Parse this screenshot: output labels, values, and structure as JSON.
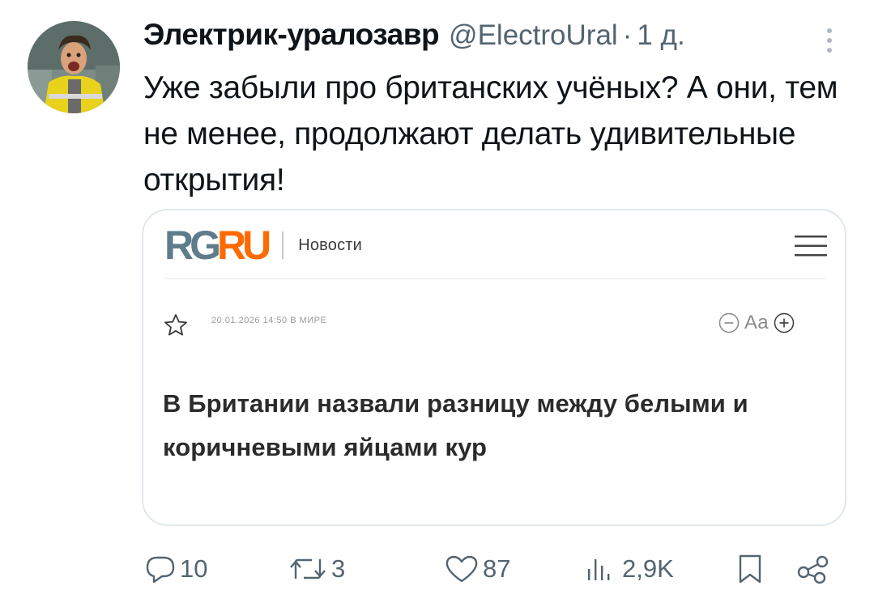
{
  "tweet": {
    "author_name": "Электрик-уралозавр",
    "handle": "@ElectroUral",
    "separator": "·",
    "time": "1 д.",
    "text": "Уже забыли про британских учёных? А они, тем не менее, продолжают делать удивительные открытия!"
  },
  "card": {
    "logo_rg": "RG",
    "logo_ru": "RU",
    "section": "Новости",
    "meta": "20.01.2026 14:50 В МИРЕ",
    "font_size_label": "Аа",
    "headline": "В Британии назвали разницу между белыми и коричневыми яйцами кур"
  },
  "actions": {
    "replies": "10",
    "retweets": "3",
    "likes": "87",
    "views": "2,9K"
  },
  "icons": {
    "more": "more-vertical-icon",
    "menu": "hamburger-menu-icon",
    "star": "star-outline-icon",
    "font_decrease": "minus-circle-icon",
    "font_increase": "plus-circle-icon",
    "reply": "reply-bubble-icon",
    "retweet": "retweet-icon",
    "like": "heart-icon",
    "views": "views-bar-icon",
    "bookmark": "bookmark-icon",
    "share": "share-icon"
  },
  "colors": {
    "text": "#0f1419",
    "muted": "#536471",
    "logo_rg": "#5f7c8a",
    "logo_ru": "#ff6a00"
  }
}
